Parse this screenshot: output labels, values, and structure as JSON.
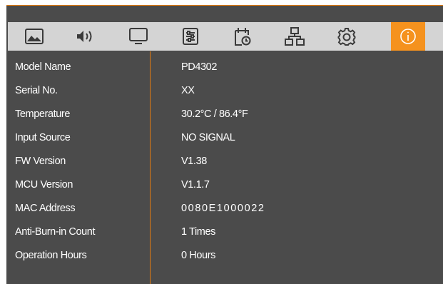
{
  "tabs": [
    {
      "icon": "picture-icon",
      "active": false
    },
    {
      "icon": "speaker-icon",
      "active": false
    },
    {
      "icon": "monitor-icon",
      "active": false
    },
    {
      "icon": "adjust-sliders-icon",
      "active": false
    },
    {
      "icon": "schedule-calendar-icon",
      "active": false
    },
    {
      "icon": "network-icon",
      "active": false
    },
    {
      "icon": "gear-icon",
      "active": false
    },
    {
      "icon": "info-icon",
      "active": true
    }
  ],
  "colors": {
    "accent": "#f5921e",
    "panel": "#4b4b4b",
    "tabbar": "#d4d4d4",
    "divider": "#e07a10"
  },
  "info": {
    "rows": [
      {
        "label": "Model Name",
        "value": "PD4302"
      },
      {
        "label": "Serial No.",
        "value": "XX"
      },
      {
        "label": "Temperature",
        "value": "30.2°C / 86.4°F"
      },
      {
        "label": "Input Source",
        "value": "NO SIGNAL"
      },
      {
        "label": "FW Version",
        "value": "V1.38"
      },
      {
        "label": "MCU Version",
        "value": "V1.1.7"
      },
      {
        "label": "MAC Address",
        "value": "0080E1000022"
      },
      {
        "label": "Anti-Burn-in Count",
        "value": "1 Times"
      },
      {
        "label": "Operation Hours",
        "value": "0 Hours"
      }
    ]
  }
}
